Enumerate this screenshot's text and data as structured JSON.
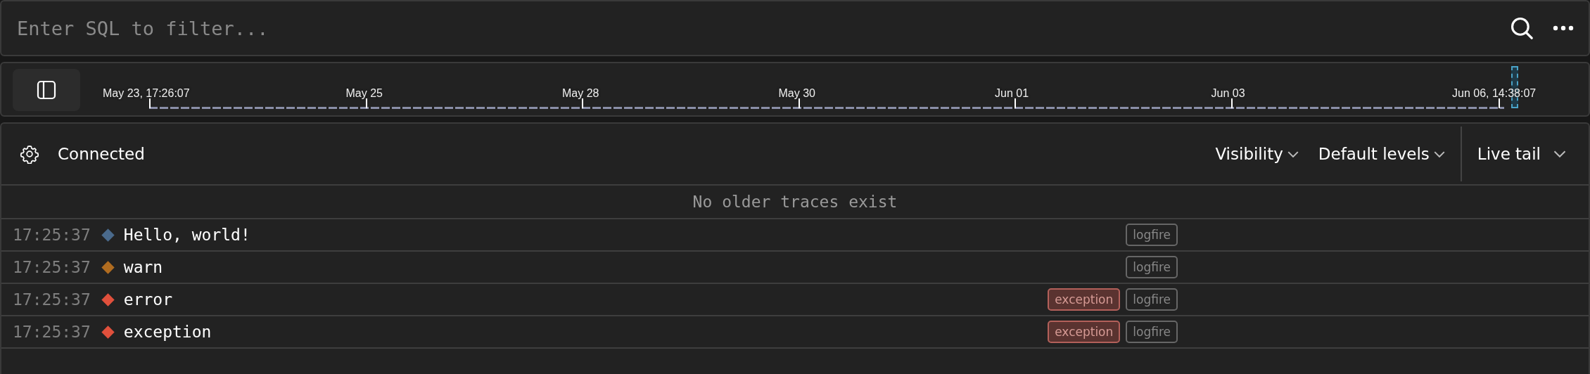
{
  "search": {
    "placeholder": "Enter SQL to filter..."
  },
  "timeline": {
    "ticks": [
      "May 23, 17:26:07",
      "May 25",
      "May 28",
      "May 30",
      "Jun 01",
      "Jun 03",
      "Jun 06, 14:38:07"
    ]
  },
  "toolbar": {
    "status": "Connected",
    "menus": [
      "Visibility",
      "Default levels"
    ],
    "live_tail": "Live tail"
  },
  "notice": "No older traces exist",
  "rows": [
    {
      "time": "17:25:37",
      "color": "#4a6a8c",
      "message": "Hello, world!",
      "tags": [
        {
          "label": "logfire",
          "kind": "service"
        }
      ]
    },
    {
      "time": "17:25:37",
      "color": "#b06c20",
      "message": "warn",
      "tags": [
        {
          "label": "logfire",
          "kind": "service"
        }
      ]
    },
    {
      "time": "17:25:37",
      "color": "#e0503c",
      "message": "error",
      "tags": [
        {
          "label": "exception",
          "kind": "exception"
        },
        {
          "label": "logfire",
          "kind": "service"
        }
      ]
    },
    {
      "time": "17:25:37",
      "color": "#e0503c",
      "message": "exception",
      "tags": [
        {
          "label": "exception",
          "kind": "exception"
        },
        {
          "label": "logfire",
          "kind": "service"
        }
      ]
    }
  ]
}
